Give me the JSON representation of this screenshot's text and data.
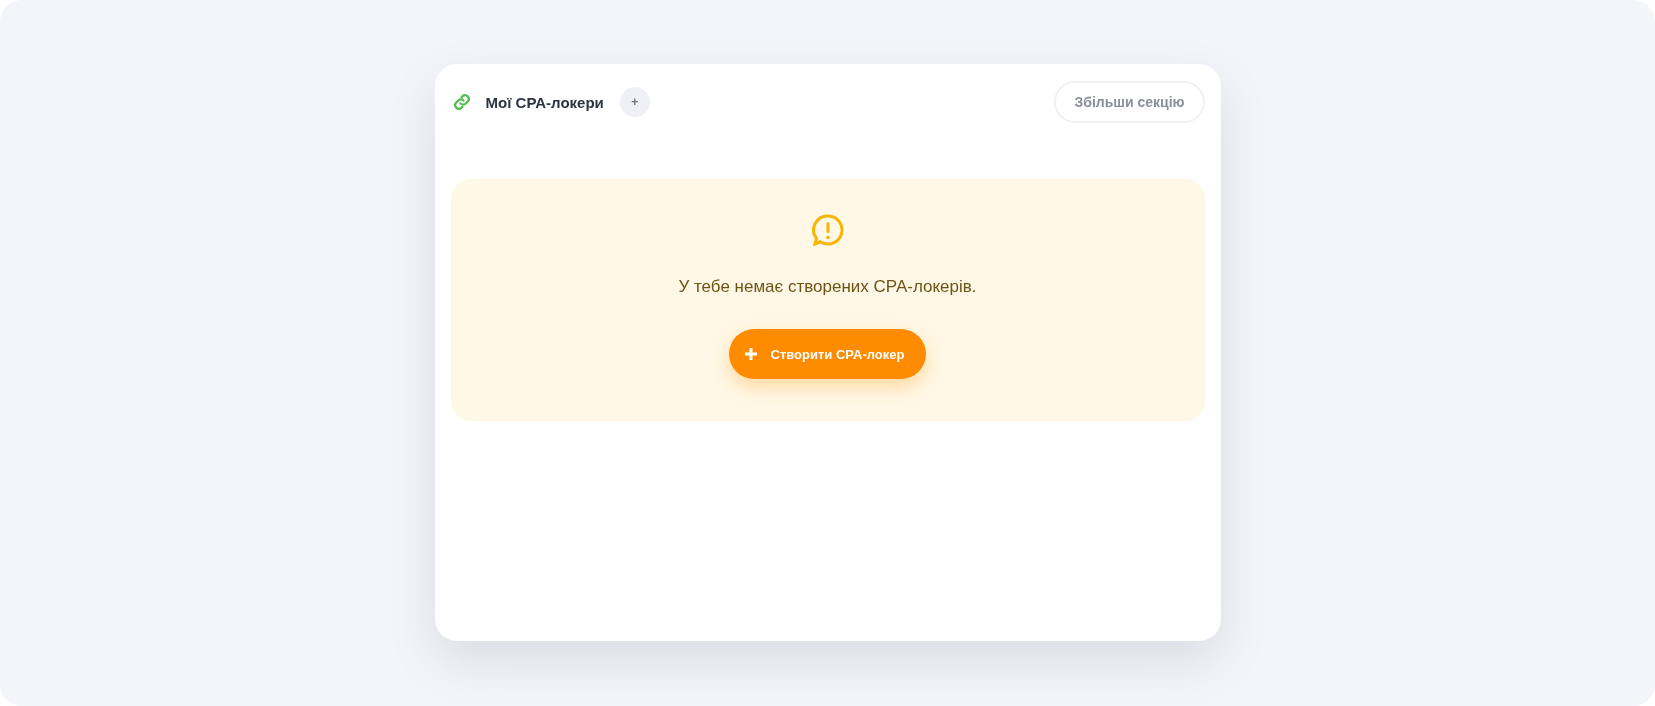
{
  "card": {
    "title": "Мої CPA-локери",
    "add_label": "+",
    "expand_button": "Збільши секцію"
  },
  "empty_state": {
    "message": "У тебе немає створених CPA-локерів.",
    "create_button": "Створити CPA-локер"
  }
}
